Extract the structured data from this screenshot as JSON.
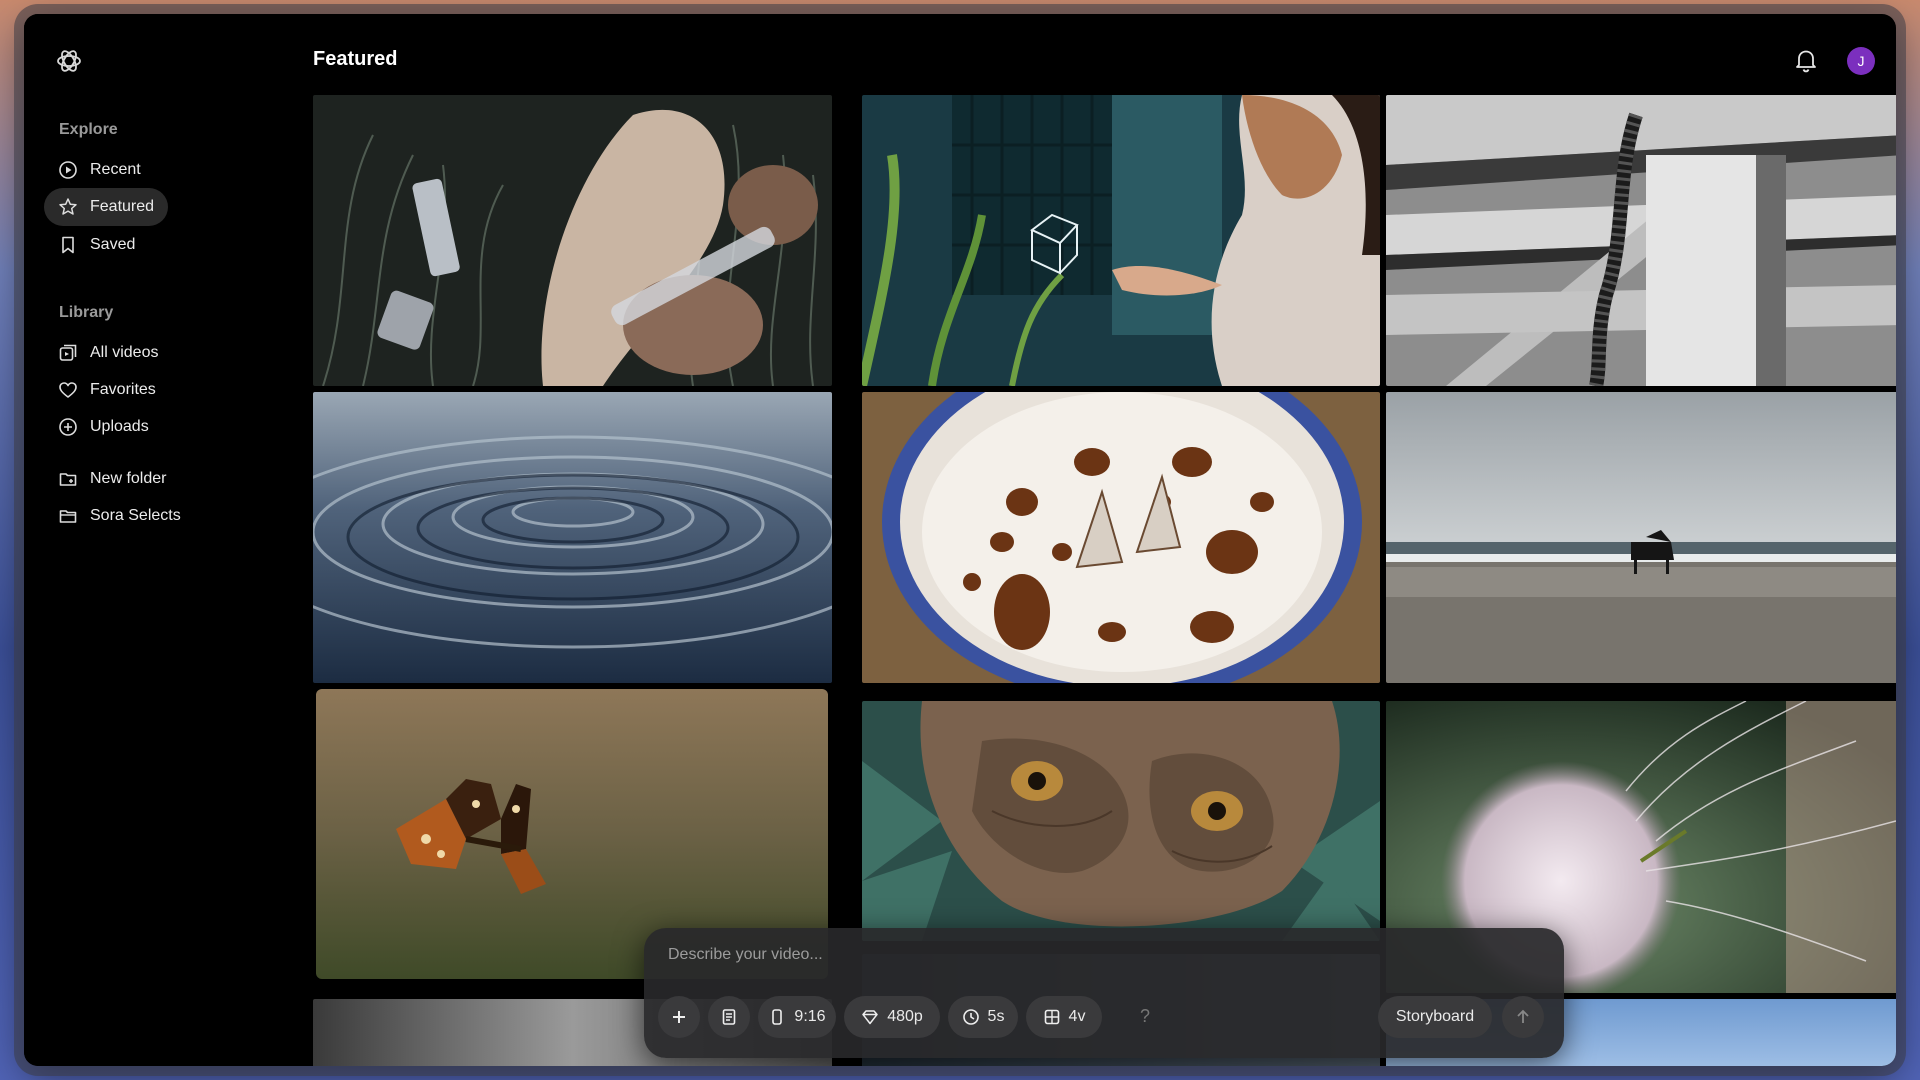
{
  "header": {
    "title": "Featured"
  },
  "user": {
    "avatar_initial": "J"
  },
  "sidebar": {
    "explore_title": "Explore",
    "explore_items": [
      {
        "label": "Recent",
        "icon": "play-circle-icon"
      },
      {
        "label": "Featured",
        "icon": "star-icon",
        "active": true
      },
      {
        "label": "Saved",
        "icon": "bookmark-icon"
      }
    ],
    "library_title": "Library",
    "library_items": [
      {
        "label": "All videos",
        "icon": "videos-icon"
      },
      {
        "label": "Favorites",
        "icon": "heart-icon"
      },
      {
        "label": "Uploads",
        "icon": "plus-circle-icon"
      }
    ],
    "folders": [
      {
        "label": "New folder",
        "icon": "folder-plus-icon"
      },
      {
        "label": "Sora Selects",
        "icon": "folder-icon"
      }
    ]
  },
  "gallery": [
    {
      "subject": "crystals-mushrooms"
    },
    {
      "subject": "girl-holding-glass-cube"
    },
    {
      "subject": "wooden-fence-millipede"
    },
    {
      "subject": "water-ripples"
    },
    {
      "subject": "coffee-foam-paper-boats"
    },
    {
      "subject": "piano-on-beach"
    },
    {
      "subject": "butterfly"
    },
    {
      "subject": "monkey-eyes"
    },
    {
      "subject": "dandelion"
    }
  ],
  "composer": {
    "placeholder": "Describe your video...",
    "aspect": "9:16",
    "resolution": "480p",
    "duration": "5s",
    "variations": "4v",
    "help": "?",
    "storyboard": "Storyboard"
  },
  "colors": {
    "background": "#000000",
    "active_nav": "#2a2a2a",
    "avatar": "#7b2fbe",
    "composer": "#28282a"
  }
}
